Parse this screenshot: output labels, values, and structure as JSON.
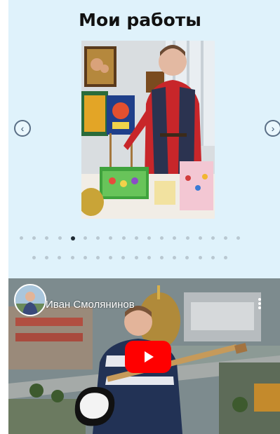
{
  "header": {
    "title": "Мои работы"
  },
  "gallery": {
    "prev_icon": "chevron-left-icon",
    "next_icon": "chevron-right-icon",
    "photo_description_icon": "photo-image",
    "pagination": {
      "row1_count": 18,
      "row2_count": 16,
      "active_index": 4
    }
  },
  "video": {
    "channel_name": "Иван Смолянинов",
    "play_icon": "youtube-play-icon",
    "menu_icon": "kebab-menu-icon"
  },
  "colors": {
    "panel_bg": "#dff2fb",
    "dot_active": "#1e2a33",
    "dot_inactive": "#b9c8d1",
    "play_red": "#ff0000"
  }
}
